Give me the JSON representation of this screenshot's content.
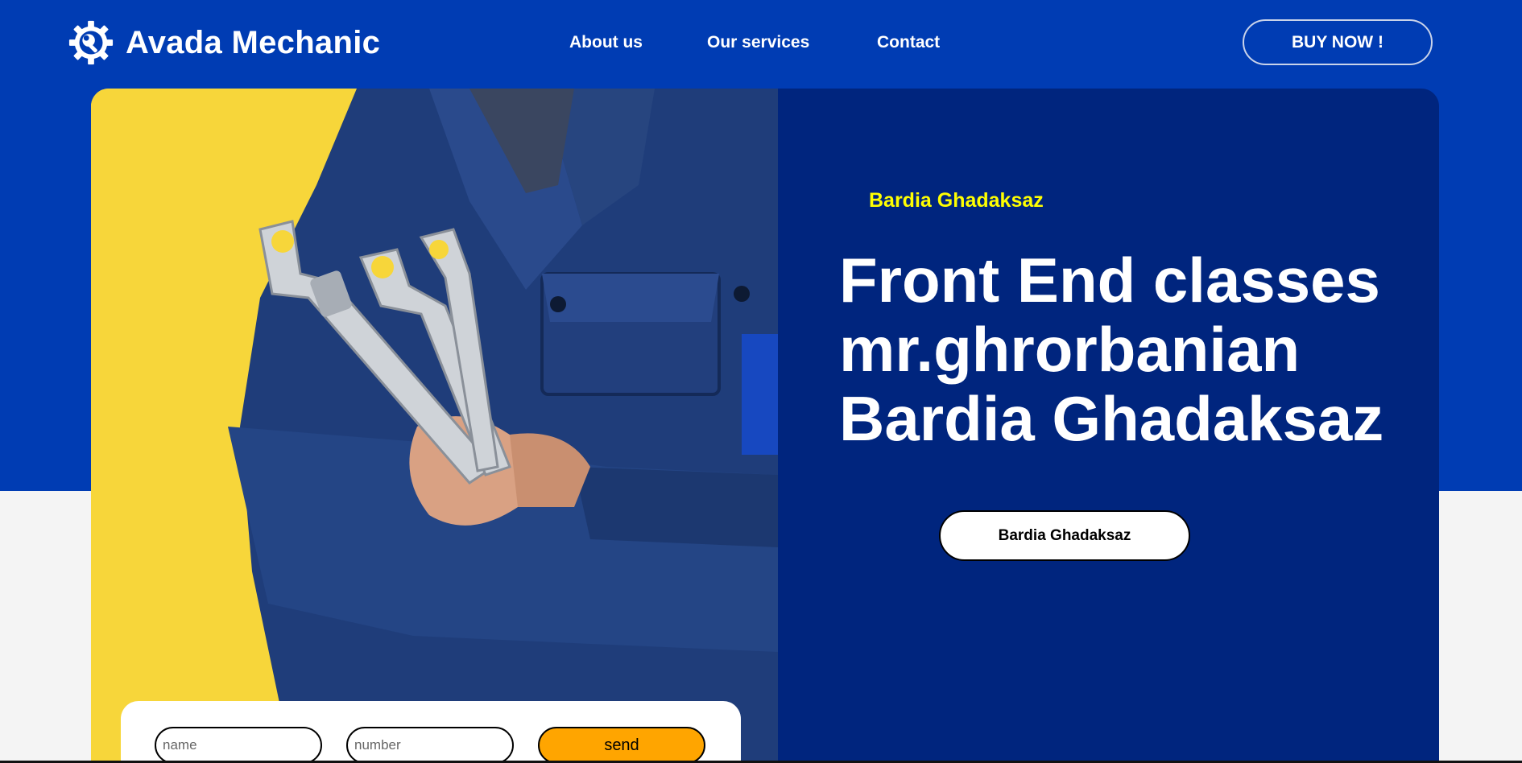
{
  "colors": {
    "header_blue": "#003cb3",
    "panel_navy": "#00257e",
    "accent_yellow": "#ffff00",
    "send_orange": "#ffa500",
    "image_yellow": "#f7d63a"
  },
  "header": {
    "logo_icon": "gear-wrench-icon",
    "brand": "Avada Mechanic",
    "nav": [
      "About us",
      "Our services",
      "Contact"
    ],
    "buy_button": "BUY NOW !"
  },
  "hero": {
    "image": "mechanic-holding-wrenches",
    "eyebrow": "Bardia Ghadaksaz",
    "headline_lines": [
      "Front End classes",
      "mr.ghrorbanian",
      "Bardia Ghadaksaz"
    ],
    "cta_label": "Bardia Ghadaksaz"
  },
  "form": {
    "name_placeholder": "name",
    "name_value": "",
    "number_placeholder": "number",
    "number_value": "",
    "send_label": "send"
  }
}
